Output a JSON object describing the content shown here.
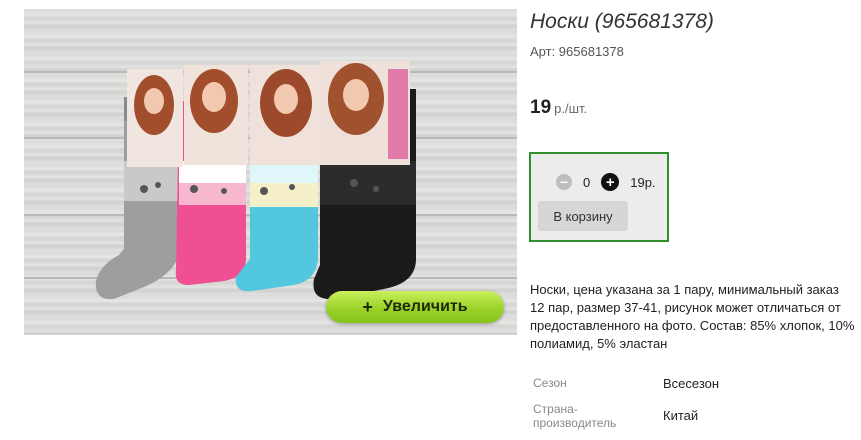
{
  "product": {
    "title": "Носки (965681378)",
    "sku": "Арт: 965681378",
    "price_value": "19",
    "price_unit": "р./шт."
  },
  "gallery": {
    "zoom_plus": "+",
    "zoom_label": "Увеличить"
  },
  "cart": {
    "minus": "−",
    "quantity": "0",
    "plus": "+",
    "total": "19р.",
    "button_label": "В корзину",
    "border_color": "#2f8f2f"
  },
  "description": "Носки, цена указана за 1 пару, минимальный заказ 12 пар, размер 37-41, рисунок может отличаться от предоставленного на фото. Состав: 85% хлопок, 10% полиамид, 5% эластан",
  "properties": [
    {
      "label": "Сезон",
      "value": "Всесезон"
    },
    {
      "label": "Страна-производитель",
      "value": "Китай"
    }
  ],
  "icons": {
    "minus": "minus-circle-icon",
    "plus": "plus-circle-icon"
  },
  "colors": {
    "sock_gray": "#9a9a9a",
    "sock_pink": "#ef4f93",
    "sock_cyan": "#53c7e0",
    "sock_black": "#1b1b1b",
    "zoom_button": "#9bd22a"
  }
}
